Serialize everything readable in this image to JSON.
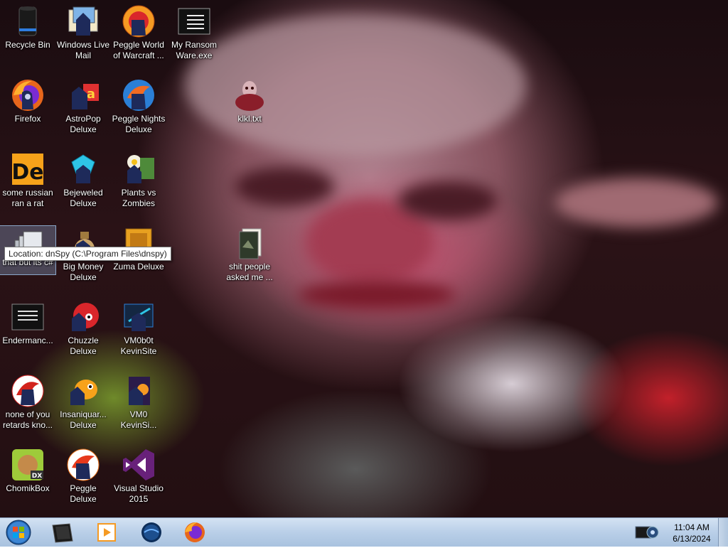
{
  "desktop": {
    "icons": [
      {
        "label": "Recycle Bin",
        "icon": "recycle-bin-icon"
      },
      {
        "label": "Windows Live Mail",
        "icon": "mail-icon"
      },
      {
        "label": "Peggle World of Warcraft ...",
        "icon": "peggle-icon"
      },
      {
        "label": "My Ransom Ware.exe",
        "icon": "executable-icon"
      },
      {
        "label": "Firefox",
        "icon": "firefox-icon"
      },
      {
        "label": "AstroPop Deluxe",
        "icon": "astropop-icon"
      },
      {
        "label": "Peggle Nights Deluxe",
        "icon": "peggle-nights-icon"
      },
      {
        "label": "klkl.txt",
        "icon": "text-file-icon"
      },
      {
        "label": "some russian ran a rat",
        "icon": "dotnet-icon"
      },
      {
        "label": "Bejeweled Deluxe",
        "icon": "bejeweled-icon"
      },
      {
        "label": "Plants vs Zombies",
        "icon": "plants-vs-zombies-icon"
      },
      {
        "label": "that but its c#",
        "icon": "dnspy-icon"
      },
      {
        "label": "Big Money Deluxe",
        "icon": "money-bag-icon"
      },
      {
        "label": "Zuma Deluxe",
        "icon": "zuma-icon"
      },
      {
        "label": "shit people asked me ...",
        "icon": "folder-icon"
      },
      {
        "label": "Endermanc...",
        "icon": "console-icon"
      },
      {
        "label": "Chuzzle Deluxe",
        "icon": "chuzzle-icon"
      },
      {
        "label": "VM0b0t KevinSite",
        "icon": "vm-icon"
      },
      {
        "label": "none of you retards kno...",
        "icon": "shortcut-icon"
      },
      {
        "label": "Insaniquar... Deluxe",
        "icon": "insaniquarium-icon"
      },
      {
        "label": "VM0 KevinSi...",
        "icon": "vm-file-icon"
      },
      {
        "label": "ChomikBox",
        "icon": "chomikbox-icon"
      },
      {
        "label": "Peggle Deluxe",
        "icon": "peggle-deluxe-icon"
      },
      {
        "label": "Visual Studio 2015",
        "icon": "visual-studio-icon"
      }
    ]
  },
  "tooltip": {
    "text": "Location: dnSpy (C:\\Program Files\\dnspy)"
  },
  "taskbar": {
    "pinned": [
      {
        "name": "command-prompt",
        "icon": "console-icon"
      },
      {
        "name": "media-player",
        "icon": "media-player-icon"
      },
      {
        "name": "globe-app",
        "icon": "globe-icon"
      },
      {
        "name": "firefox",
        "icon": "firefox-icon"
      }
    ],
    "tray_icon": "network-icon",
    "clock": {
      "time": "11:04 AM",
      "date": "6/13/2024"
    }
  },
  "colors": {
    "taskbar": "#b9cfe8",
    "selection": "#8aa6c8",
    "label_text": "#ffffff"
  }
}
